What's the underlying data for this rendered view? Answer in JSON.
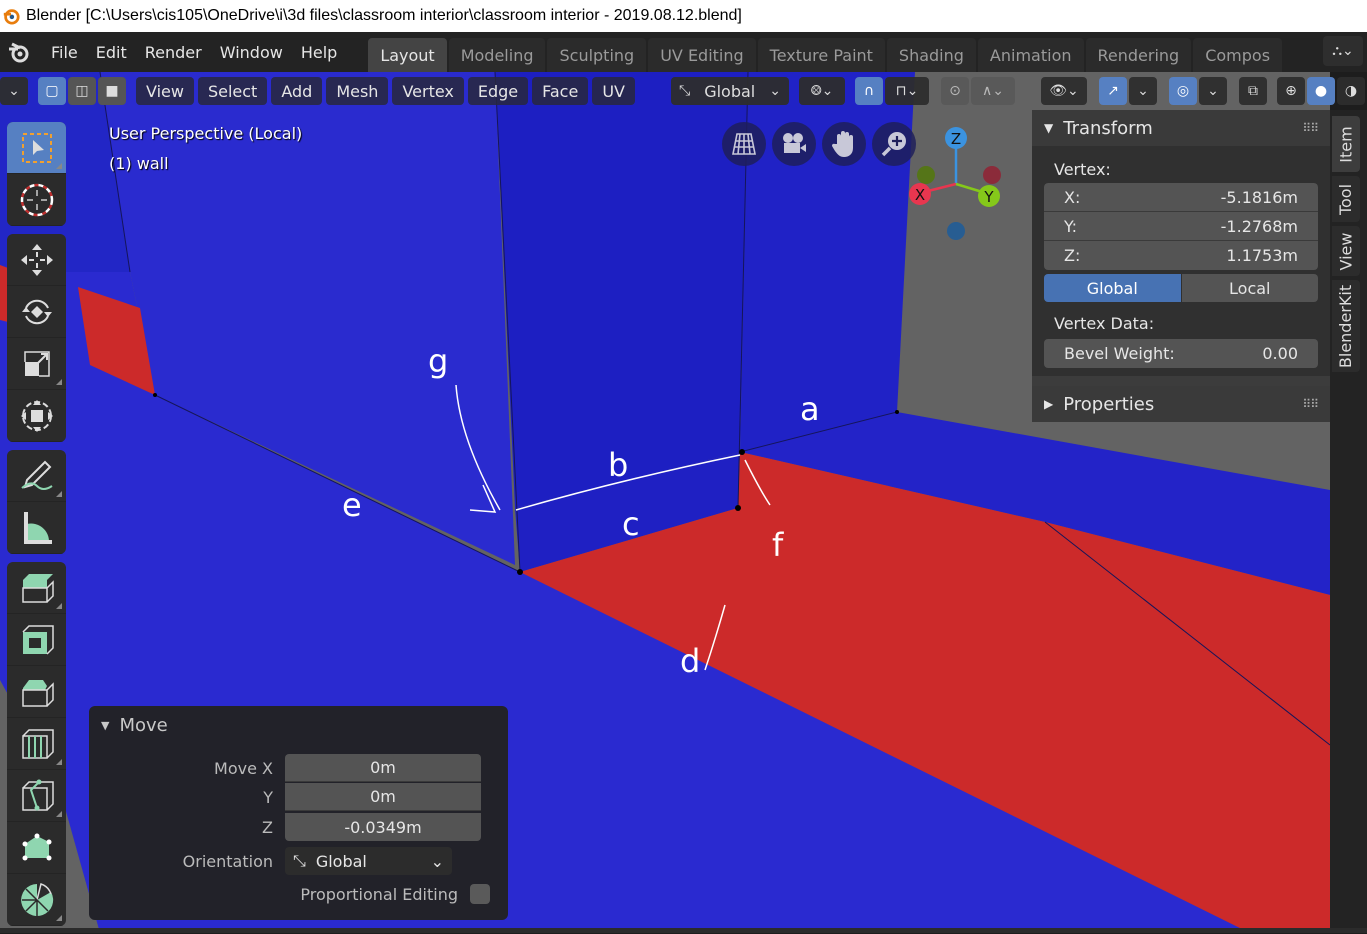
{
  "window": {
    "title": "Blender [C:\\Users\\cis105\\OneDrive\\i\\3d files\\classroom interior\\classroom interior - 2019.08.12.blend]"
  },
  "menu": [
    "File",
    "Edit",
    "Render",
    "Window",
    "Help"
  ],
  "workspaces": [
    {
      "label": "Layout",
      "active": true
    },
    {
      "label": "Modeling"
    },
    {
      "label": "Sculpting"
    },
    {
      "label": "UV Editing"
    },
    {
      "label": "Texture Paint"
    },
    {
      "label": "Shading"
    },
    {
      "label": "Animation"
    },
    {
      "label": "Rendering"
    },
    {
      "label": "Compos"
    }
  ],
  "header": {
    "menus": [
      "View",
      "Select",
      "Add",
      "Mesh",
      "Vertex",
      "Edge",
      "Face",
      "UV"
    ],
    "orientation": "Global",
    "select_mode": "vertex"
  },
  "viewport": {
    "perspective": "User Perspective (Local)",
    "object": "(1) wall",
    "annotations": [
      "a",
      "b",
      "c",
      "d",
      "e",
      "f",
      "g"
    ],
    "gizmo_axes": [
      "X",
      "Y",
      "Z"
    ],
    "colors": {
      "blue_face": "#2326c8",
      "red_face": "#cc2a2a",
      "grey_wall": "#636363"
    }
  },
  "toolbar": {
    "tools": [
      "select-box",
      "cursor",
      "move",
      "rotate",
      "scale",
      "transform",
      "annotate",
      "measure",
      "extrude-region",
      "inset-faces",
      "bevel",
      "loop-cut",
      "knife",
      "poly-build",
      "spin"
    ],
    "active": "select-box"
  },
  "sidebar": {
    "tabs": [
      "Item",
      "Tool",
      "View",
      "BlenderKit"
    ],
    "active_tab": "Item",
    "transform": {
      "title": "Transform",
      "vertex_label": "Vertex:",
      "x_label": "X:",
      "x": "-5.1816m",
      "y_label": "Y:",
      "y": "-1.2768m",
      "z_label": "Z:",
      "z": "1.1753m",
      "global": "Global",
      "local": "Local",
      "vertex_data_label": "Vertex Data:",
      "bevel_weight_label": "Bevel Weight:",
      "bevel_weight": "0.00"
    },
    "properties_title": "Properties"
  },
  "redo_panel": {
    "title": "Move",
    "move_x_label": "Move X",
    "move_x": "0m",
    "y_label": "Y",
    "y": "0m",
    "z_label": "Z",
    "z": "-0.0349m",
    "orientation_label": "Orientation",
    "orientation": "Global",
    "proportional_label": "Proportional Editing",
    "proportional": false
  }
}
